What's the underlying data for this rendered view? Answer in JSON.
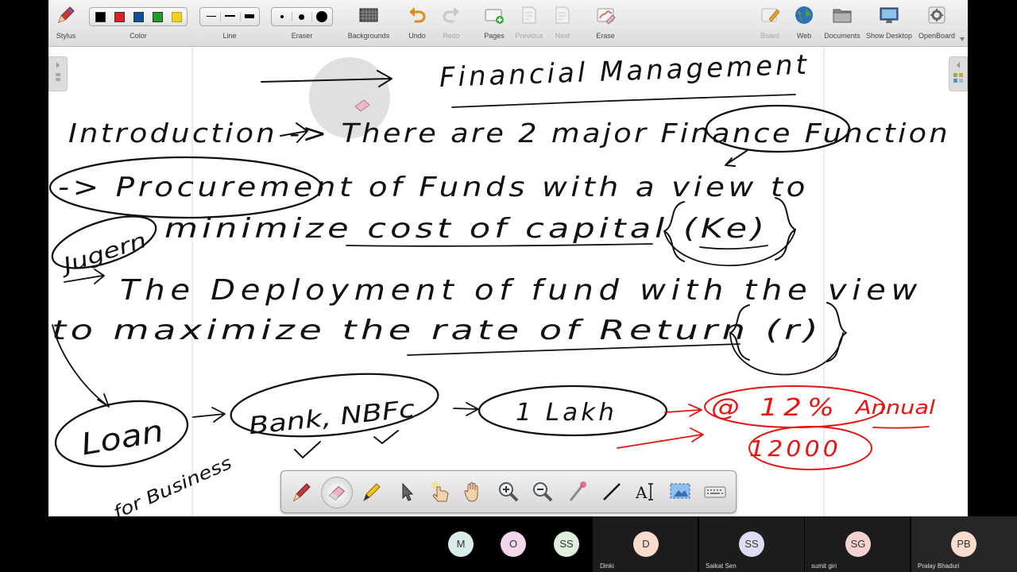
{
  "toolbar": {
    "stylus": "Stylus",
    "color": "Color",
    "line": "Line",
    "eraser": "Eraser",
    "backgrounds": "Backgrounds",
    "undo": "Undo",
    "redo": "Redo",
    "pages": "Pages",
    "previous": "Previous",
    "next": "Next",
    "erase": "Erase",
    "board": "Board",
    "web": "Web",
    "documents": "Documents",
    "show_desktop": "Show Desktop",
    "openboard": "OpenBoard",
    "colors": [
      "#000000",
      "#e02020",
      "#1050a0",
      "#20a020",
      "#f0d020"
    ]
  },
  "board": {
    "title": "Financial Management",
    "line1": "Introduction -> There are 2 major Finance Function",
    "line2": "-> Procurement of Funds with a view to",
    "line3_tag": "Jugern",
    "line3": "minimize cost of capital (Ke)",
    "line4": "The Deployment of fund with the view",
    "line5": "to maximize the rate of Return (r)",
    "loan": "Loan",
    "banks": "Bank, NBFc",
    "lakh": "1 Lakh",
    "for_business": "for Business",
    "rate": "@ 12%",
    "annual": "Annual",
    "interest": "12000",
    "ink_colors": {
      "black": "#111111",
      "red": "#e8140f"
    }
  },
  "palette": {
    "tools": [
      "pen-tool",
      "eraser-tool",
      "highlighter-tool",
      "selector-tool",
      "hand-pointer-tool",
      "pan-hand-tool",
      "zoom-in-tool",
      "zoom-out-tool",
      "laser-pointer-tool",
      "line-tool",
      "text-tool",
      "capture-tool",
      "keyboard-tool"
    ]
  },
  "participants": [
    {
      "initials": "M",
      "name": "",
      "color": "#d8ecec"
    },
    {
      "initials": "O",
      "name": "",
      "color": "#f2d6ec"
    },
    {
      "initials": "SS",
      "name": "",
      "color": "#dfeedd"
    },
    {
      "initials": "D",
      "name": "Dinki",
      "color": "#f9dccb"
    },
    {
      "initials": "SS",
      "name": "Saikat Sen",
      "color": "#dcdcf2"
    },
    {
      "initials": "SG",
      "name": "sumit giri",
      "color": "#f6d2d2"
    },
    {
      "initials": "PB",
      "name": "Pralay Bhaduri",
      "color": "#f9dccb"
    }
  ]
}
